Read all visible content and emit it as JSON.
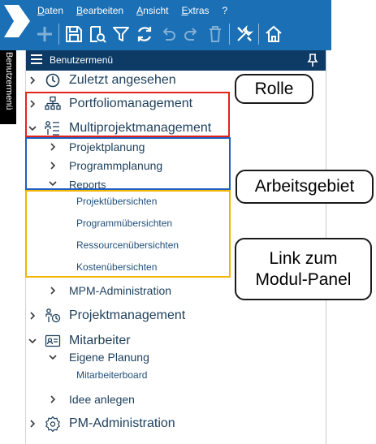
{
  "menu": [
    "Daten",
    "Bearbeiten",
    "Ansicht",
    "Extras",
    "?"
  ],
  "toolbar_icons": [
    "new-icon",
    "save-icon",
    "search-icon",
    "filter-icon",
    "refresh-icon",
    "undo-icon",
    "redo-icon",
    "delete-icon",
    "tools-icon",
    "home-icon"
  ],
  "vertical_tab": "Benutzermenü",
  "panel": {
    "title": "Benutzermenü"
  },
  "tree": {
    "recent": "Zuletzt angesehen",
    "portfolio": "Portfoliomanagement",
    "multiprojekt": "Multiprojektmanagement",
    "projektplanung": "Projektplanung",
    "programmplanung": "Programmplanung",
    "reports": "Reports",
    "projektuebersichten": "Projektübersichten",
    "programmuebersichten": "Programmübersichten",
    "ressourcenuebersichten": "Ressourcenübersichten",
    "kostenuebersichten": "Kostenübersichten",
    "mpm_admin": "MPM-Administration",
    "projektmanagement": "Projektmanagement",
    "mitarbeiter": "Mitarbeiter",
    "eigene_planung": "Eigene Planung",
    "mitarbeiterboard": "Mitarbeiterboard",
    "idee": "Idee anlegen",
    "pm_admin": "PM-Administration"
  },
  "callouts": {
    "rolle": "Rolle",
    "arbeitsgebiet": "Arbeitsgebiet",
    "link_line1": "Link zum",
    "link_line2": "Modul-Panel"
  },
  "colors": {
    "appbar": "#1a6fb5",
    "panel_header": "#0d3b66",
    "role_box": "#e2231a",
    "area_box": "#1f5fbf",
    "link_box": "#f5b400"
  }
}
